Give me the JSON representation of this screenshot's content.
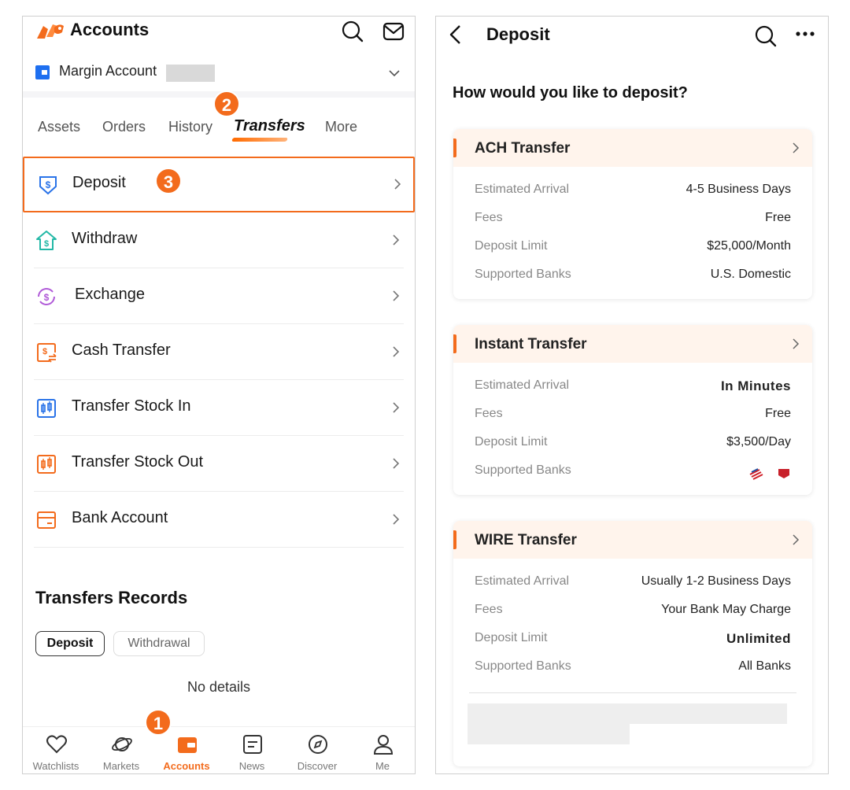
{
  "left": {
    "header": {
      "title": "Accounts"
    },
    "account": {
      "label": "Margin Account"
    },
    "tabs": [
      {
        "label": "Assets"
      },
      {
        "label": "Orders"
      },
      {
        "label": "History"
      },
      {
        "label": "Transfers"
      },
      {
        "label": "More"
      }
    ],
    "active_tab": "Transfers",
    "menu": [
      {
        "label": "Deposit",
        "icon": "deposit-icon"
      },
      {
        "label": "Withdraw",
        "icon": "withdraw-icon"
      },
      {
        "label": "Exchange",
        "icon": "exchange-icon"
      },
      {
        "label": "Cash Transfer",
        "icon": "cash-transfer-icon"
      },
      {
        "label": "Transfer Stock In",
        "icon": "stock-in-icon"
      },
      {
        "label": "Transfer Stock Out",
        "icon": "stock-out-icon"
      },
      {
        "label": "Bank Account",
        "icon": "bank-account-icon"
      }
    ],
    "records": {
      "title": "Transfers Records",
      "chips": [
        "Deposit",
        "Withdrawal"
      ],
      "empty_text": "No details"
    },
    "bottom_nav": [
      {
        "label": "Watchlists",
        "icon": "heart-icon"
      },
      {
        "label": "Markets",
        "icon": "planet-icon"
      },
      {
        "label": "Accounts",
        "icon": "wallet-icon"
      },
      {
        "label": "News",
        "icon": "news-icon"
      },
      {
        "label": "Discover",
        "icon": "compass-icon"
      },
      {
        "label": "Me",
        "icon": "person-icon"
      }
    ],
    "active_nav": "Accounts",
    "step_badges": [
      "1",
      "2",
      "3"
    ]
  },
  "right": {
    "header": {
      "title": "Deposit"
    },
    "question": "How would you like to deposit?",
    "cards": [
      {
        "title": "ACH Transfer",
        "rows": [
          {
            "label": "Estimated Arrival",
            "value": "4-5 Business Days"
          },
          {
            "label": "Fees",
            "value": "Free"
          },
          {
            "label": "Deposit Limit",
            "value": "$25,000/Month"
          },
          {
            "label": "Supported Banks",
            "value": "U.S. Domestic"
          }
        ]
      },
      {
        "title": "Instant Transfer",
        "rows": [
          {
            "label": "Estimated Arrival",
            "value": "In Minutes",
            "bold": true
          },
          {
            "label": "Fees",
            "value": "Free"
          },
          {
            "label": "Deposit Limit",
            "value": "$3,500/Day"
          },
          {
            "label": "Supported Banks",
            "value": "",
            "logos": true
          }
        ]
      },
      {
        "title": "WIRE Transfer",
        "rows": [
          {
            "label": "Estimated Arrival",
            "value": "Usually 1-2 Business Days"
          },
          {
            "label": "Fees",
            "value": "Your Bank May Charge"
          },
          {
            "label": "Deposit Limit",
            "value": "Unlimited",
            "bold": true
          },
          {
            "label": "Supported Banks",
            "value": "All Banks"
          }
        ]
      }
    ]
  },
  "colors": {
    "accent": "#f36b1c",
    "card_header": "#fff4ec",
    "account_icon": "#1e6ff0",
    "withdraw_icon": "#22b8a6",
    "exchange_icon": "#b05ad8",
    "stock_icon": "#2a73e8"
  }
}
